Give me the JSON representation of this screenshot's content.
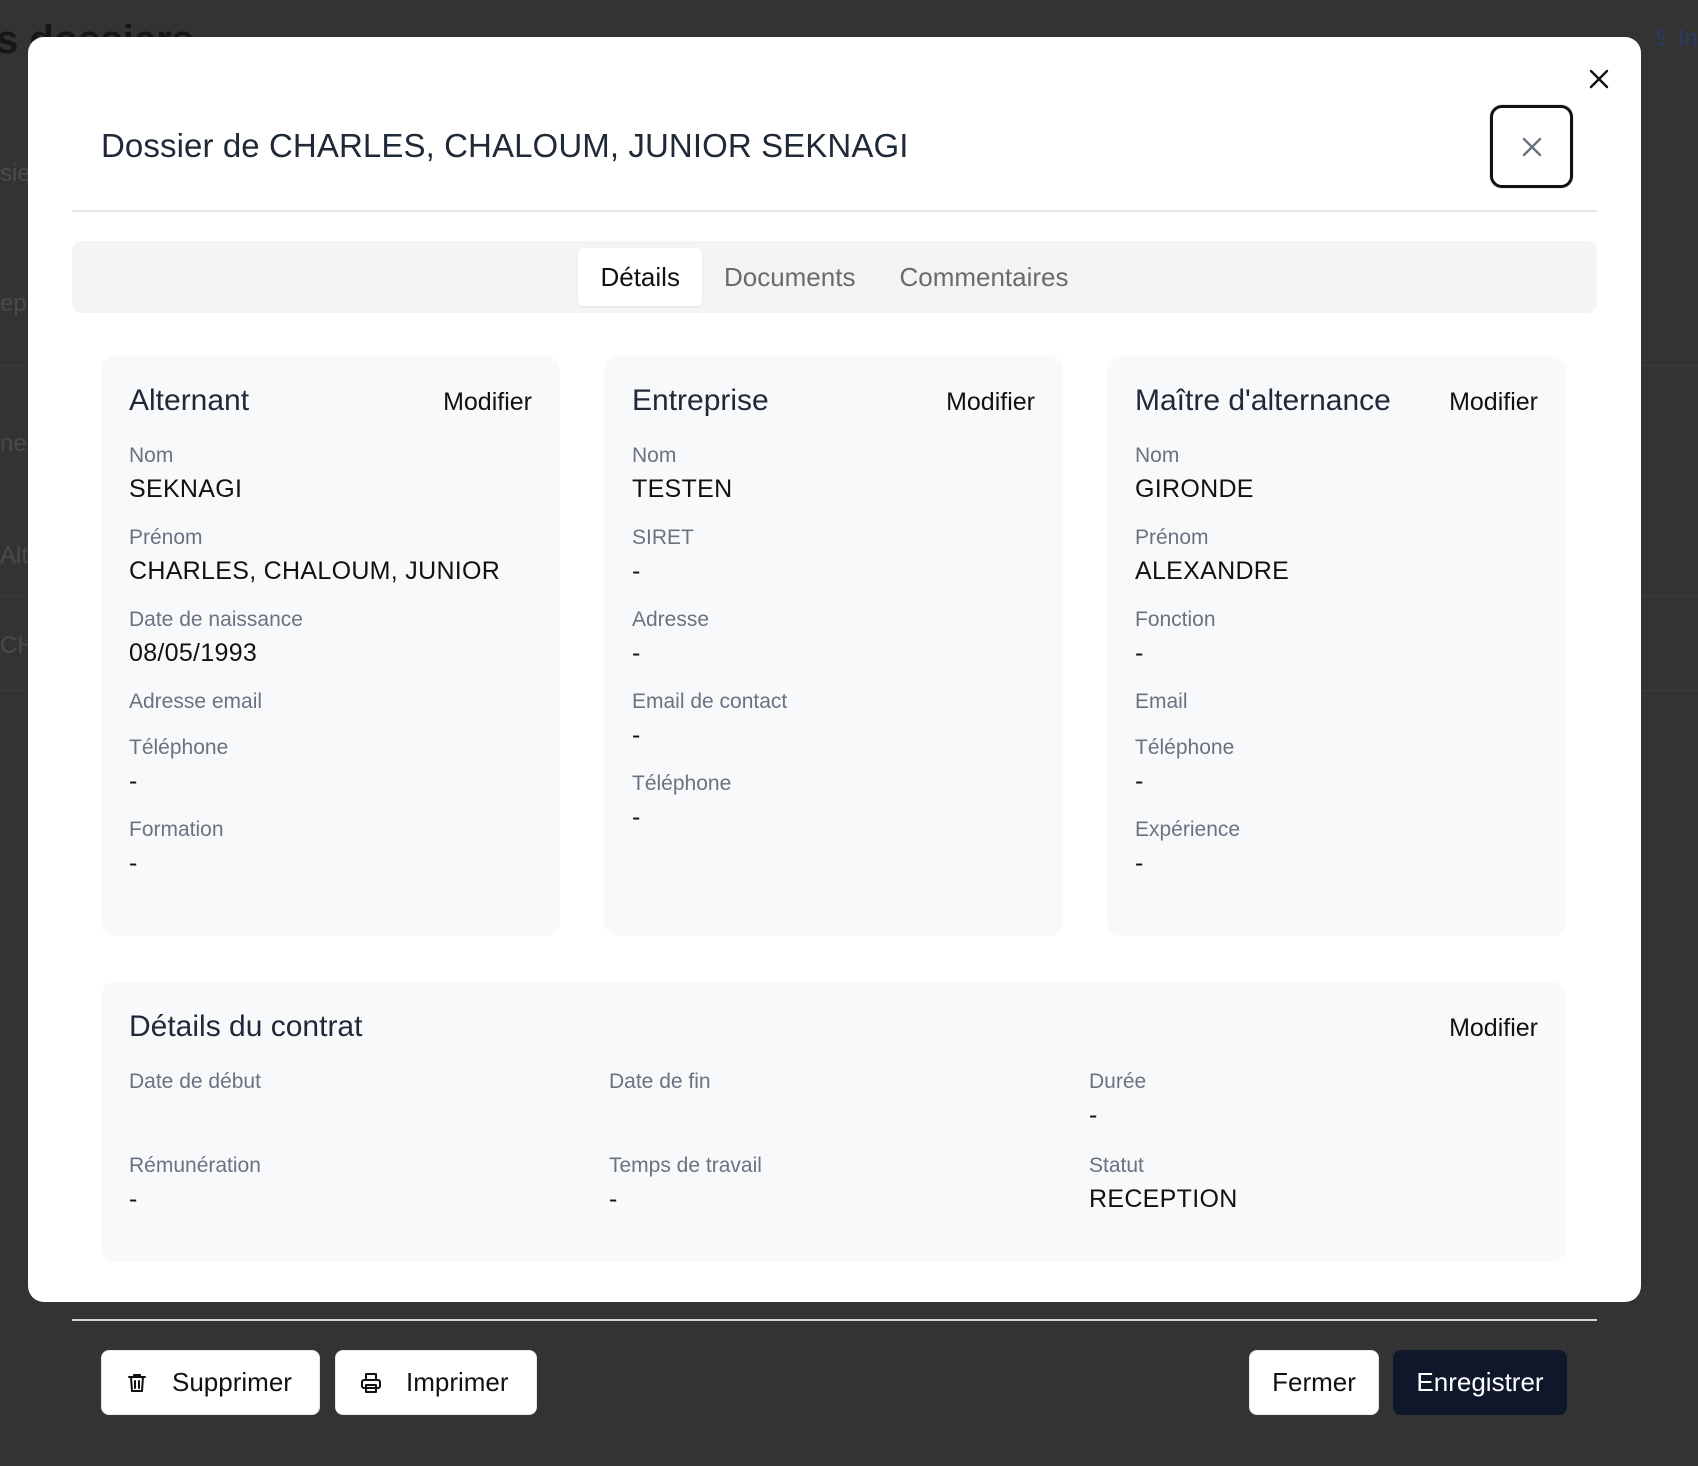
{
  "background": {
    "title_fragment": "s dossiers",
    "top_action_fragment": "In",
    "left_fragments": [
      "sie",
      "ep",
      "ne",
      "Alt",
      "CH"
    ]
  },
  "modal": {
    "title": "Dossier de CHARLES, CHALOUM, JUNIOR SEKNAGI",
    "close_icon": "close-icon",
    "tabs": [
      {
        "label": "Détails",
        "active": true
      },
      {
        "label": "Documents",
        "active": false
      },
      {
        "label": "Commentaires",
        "active": false
      }
    ],
    "cards": {
      "alternant": {
        "title": "Alternant",
        "edit_label": "Modifier",
        "fields": [
          {
            "label": "Nom",
            "value": "SEKNAGI"
          },
          {
            "label": "Prénom",
            "value": "CHARLES, CHALOUM, JUNIOR"
          },
          {
            "label": "Date de naissance",
            "value": "08/05/1993"
          },
          {
            "label": "Adresse email",
            "value": ""
          },
          {
            "label": "Téléphone",
            "value": "-"
          },
          {
            "label": "Formation",
            "value": "-"
          }
        ]
      },
      "entreprise": {
        "title": "Entreprise",
        "edit_label": "Modifier",
        "fields": [
          {
            "label": "Nom",
            "value": "TESTEN"
          },
          {
            "label": "SIRET",
            "value": "-"
          },
          {
            "label": "Adresse",
            "value": "-"
          },
          {
            "label": "Email de contact",
            "value": "-"
          },
          {
            "label": "Téléphone",
            "value": "-"
          }
        ]
      },
      "maitre": {
        "title": "Maître d'alternance",
        "edit_label": "Modifier",
        "fields": [
          {
            "label": "Nom",
            "value": "GIRONDE"
          },
          {
            "label": "Prénom",
            "value": "ALEXANDRE"
          },
          {
            "label": "Fonction",
            "value": "-"
          },
          {
            "label": "Email",
            "value": ""
          },
          {
            "label": "Téléphone",
            "value": "-"
          },
          {
            "label": "Expérience",
            "value": "-"
          }
        ]
      },
      "contrat": {
        "title": "Détails du contrat",
        "edit_label": "Modifier",
        "fields": [
          {
            "label": "Date de début",
            "value": ""
          },
          {
            "label": "Date de fin",
            "value": ""
          },
          {
            "label": "Durée",
            "value": "-"
          },
          {
            "label": "Rémunération",
            "value": "-"
          },
          {
            "label": "Temps de travail",
            "value": "-"
          },
          {
            "label": "Statut",
            "value": "RECEPTION"
          }
        ]
      }
    }
  },
  "footer": {
    "delete_label": "Supprimer",
    "delete_icon": "trash-icon",
    "print_label": "Imprimer",
    "print_icon": "printer-icon",
    "close_label": "Fermer",
    "save_label": "Enregistrer",
    "save_color": "#0f172a"
  }
}
